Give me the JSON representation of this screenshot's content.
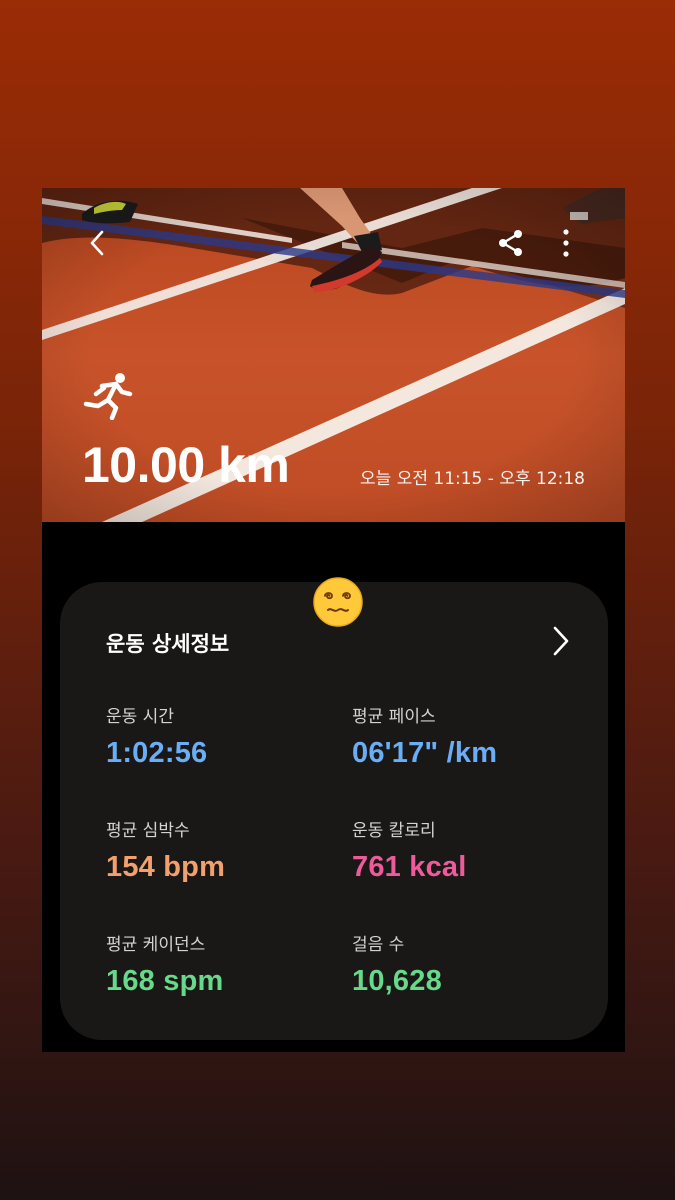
{
  "activity": {
    "distance": "10.00 km",
    "time_range": "오늘 오전 11:15 - 오후 12:18"
  },
  "icons": {
    "back": "chevron-left-icon",
    "share": "share-icon",
    "more": "more-vertical-icon",
    "activity": "running-icon",
    "emoji": "dizzy-face-emoji",
    "details": "chevron-right-icon"
  },
  "details": {
    "title": "운동 상세정보",
    "stats": [
      {
        "label": "운동 시간",
        "value": "1:02:56",
        "color": "#6aaef5"
      },
      {
        "label": "평균 페이스",
        "value": "06'17\" /km",
        "color": "#6aaef5"
      },
      {
        "label": "평균 심박수",
        "value": "154 bpm",
        "color": "#f2a06e"
      },
      {
        "label": "운동 칼로리",
        "value": "761 kcal",
        "color": "#ee5b9a"
      },
      {
        "label": "평균 케이던스",
        "value": "168 spm",
        "color": "#66d98b"
      },
      {
        "label": "걸음 수",
        "value": "10,628",
        "color": "#66d98b"
      }
    ]
  }
}
